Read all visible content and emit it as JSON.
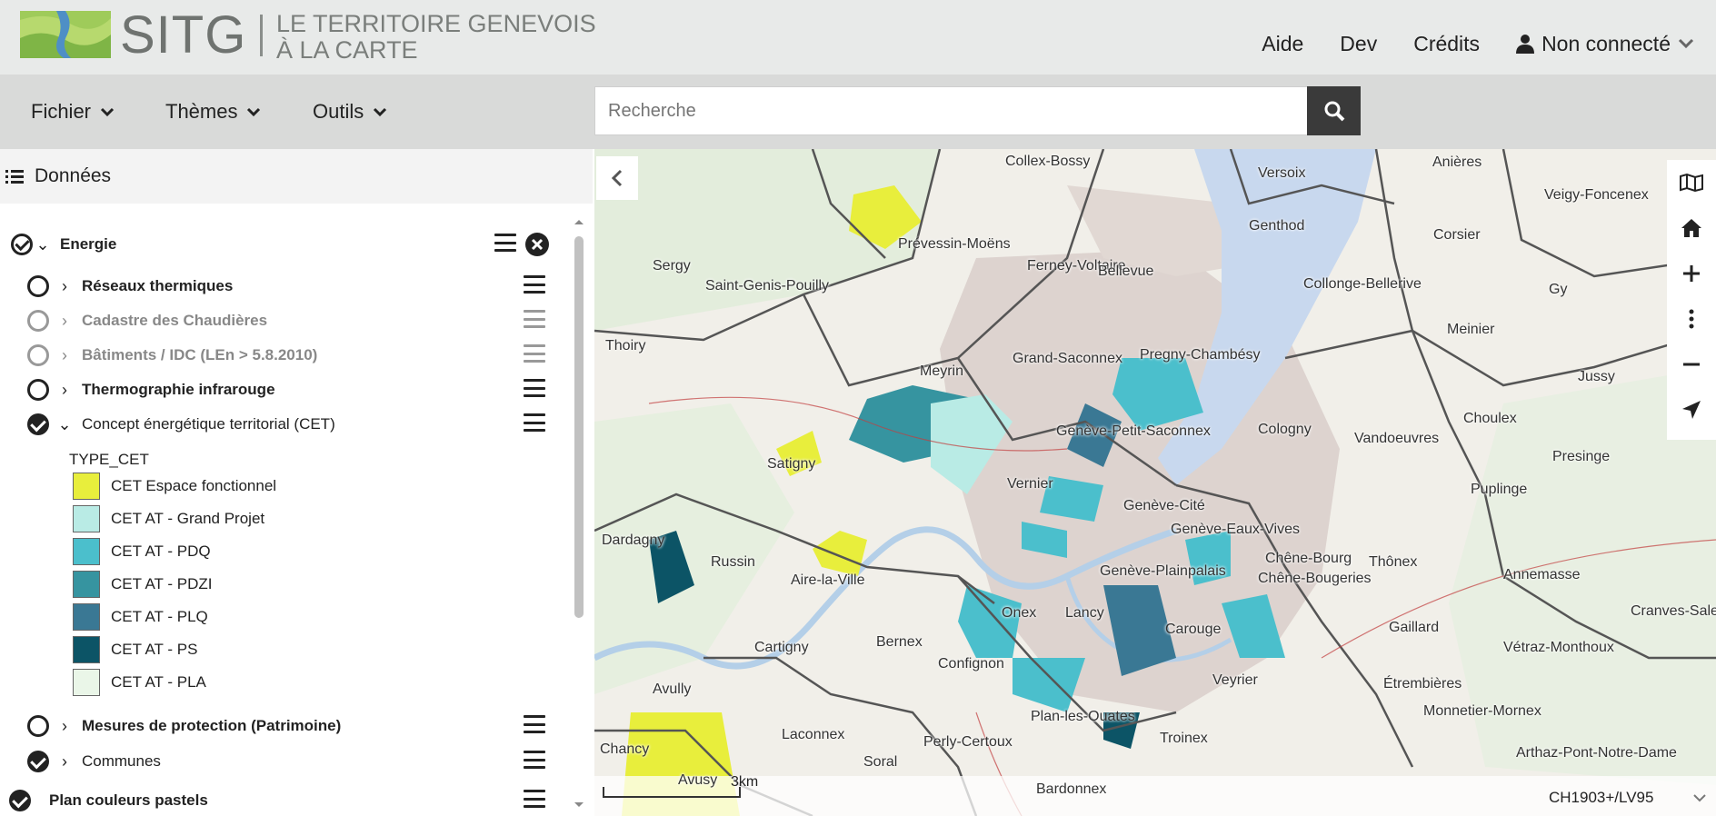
{
  "header": {
    "brand": "SITG",
    "tagline_line1": "LE TERRITOIRE GENEVOIS",
    "tagline_line2": "À LA CARTE",
    "nav": {
      "help": "Aide",
      "dev": "Dev",
      "credits": "Crédits",
      "user": "Non connecté"
    }
  },
  "menubar": {
    "file": "Fichier",
    "themes": "Thèmes",
    "tools": "Outils",
    "search_placeholder": "Recherche"
  },
  "panel": {
    "title": "Données",
    "group": {
      "label": "Energie"
    },
    "layers": [
      {
        "label": "Réseaux thermiques"
      },
      {
        "label": "Cadastre des Chaudières"
      },
      {
        "label": "Bâtiments / IDC (LEn > 5.8.2010)"
      },
      {
        "label": "Thermographie infrarouge"
      },
      {
        "label": "Concept énergétique territorial (CET)"
      }
    ],
    "legend": {
      "title": "TYPE_CET",
      "items": [
        {
          "label": "CET Espace fonctionnel",
          "color": "#e8ee3c"
        },
        {
          "label": "CET AT - Grand Projet",
          "color": "#b9ebe5"
        },
        {
          "label": "CET AT - PDQ",
          "color": "#4bbfcc"
        },
        {
          "label": "CET AT - PDZI",
          "color": "#3694a0"
        },
        {
          "label": "CET AT - PLQ",
          "color": "#3a7894"
        },
        {
          "label": "CET AT - PS",
          "color": "#0c5466"
        },
        {
          "label": "CET AT - PLA",
          "color": "#eaf6e8"
        }
      ]
    },
    "layers_after": [
      {
        "label": "Mesures de protection (Patrimoine)"
      },
      {
        "label": "Communes"
      }
    ],
    "base_layer": {
      "label": "Plan couleurs pastels"
    }
  },
  "map": {
    "scale_label": "3km",
    "projection": "CH1903+/LV95",
    "places": [
      "Collex-Bossy",
      "Versoix",
      "Anières",
      "Veigy-Foncenex",
      "Genthod",
      "Corsier",
      "Sergy",
      "Prévessin-Moëns",
      "Ferney-Voltaire",
      "Bellevue",
      "Collonge-Bellerive",
      "Saint-Genis-Pouilly",
      "Meinier",
      "Gy",
      "Thoiry",
      "Pregny-Chambésy",
      "Grand-Saconnex",
      "Meyrin",
      "Jussy",
      "Choulex",
      "Cologny",
      "Vandoeuvres",
      "Genève-Petit-Saconnex",
      "Satigny",
      "Vernier",
      "Presinge",
      "Genève-Cité",
      "Puplinge",
      "Genève-Eaux-Vives",
      "Dardagny",
      "Russin",
      "Aire-la-Ville",
      "Chêne-Bourg",
      "Thônex",
      "Genève-Plainpalais",
      "Chêne-Bougeries",
      "Annemasse",
      "Onex",
      "Lancy",
      "Carouge",
      "Gaillard",
      "Cranves-Sales",
      "Cartigny",
      "Bernex",
      "Confignon",
      "Vétraz-Monthoux",
      "Avully",
      "Plan-les-Ouates",
      "Veyrier",
      "Étrembières",
      "Monnetier-Mornex",
      "Laconnex",
      "Chancy",
      "Perly-Certoux",
      "Troinex",
      "Soral",
      "Bardonnex",
      "Avusy",
      "Arthaz-Pont-Notre-Dame"
    ]
  }
}
